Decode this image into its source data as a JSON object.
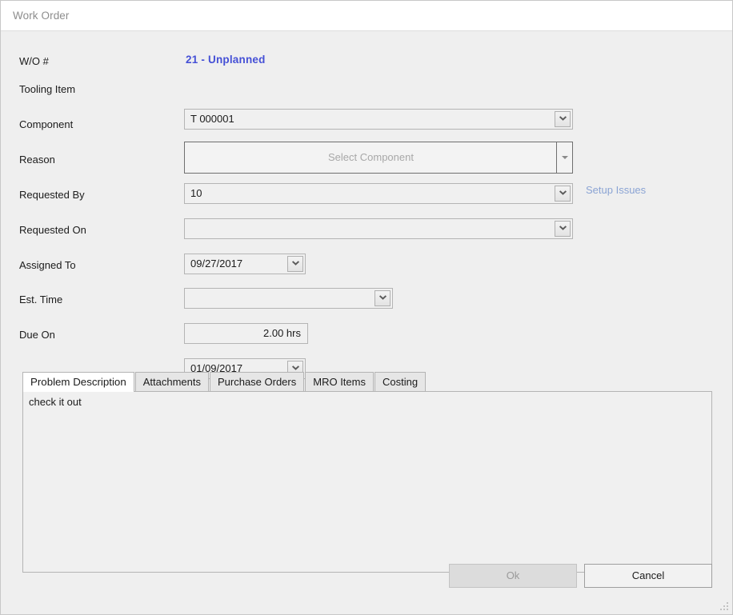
{
  "window": {
    "title": "Work Order"
  },
  "form": {
    "wo_number": {
      "label": "W/O #",
      "value": "21 - Unplanned",
      "color": "#4550d6"
    },
    "fields": [
      {
        "name": "tooling-item",
        "label": "Tooling Item",
        "value": "T 000001",
        "placeholder": "",
        "control": "combobox"
      },
      {
        "name": "component",
        "label": "Component",
        "value": "",
        "placeholder": "Select Component",
        "control": "picker"
      },
      {
        "name": "reason",
        "label": "Reason",
        "value": "10",
        "placeholder": "",
        "control": "combobox"
      },
      {
        "name": "requested-by",
        "label": "Requested By",
        "value": "",
        "placeholder": "",
        "control": "combobox"
      },
      {
        "name": "requested-on",
        "label": "Requested On",
        "value": "09/27/2017",
        "placeholder": "",
        "control": "datepicker"
      },
      {
        "name": "assigned-to",
        "label": "Assigned To",
        "value": "",
        "placeholder": "",
        "control": "combobox"
      },
      {
        "name": "est-time",
        "label": "Est. Time",
        "value": "2.00 hrs",
        "placeholder": "",
        "control": "textbox"
      },
      {
        "name": "due-on",
        "label": "Due On",
        "value": "01/09/2017",
        "placeholder": "",
        "control": "datepicker"
      }
    ],
    "setup_issues_link": "Setup Issues"
  },
  "tabs": {
    "items": [
      {
        "label": "Problem Description",
        "active": true
      },
      {
        "label": "Attachments",
        "active": false
      },
      {
        "label": "Purchase Orders",
        "active": false
      },
      {
        "label": "MRO Items",
        "active": false
      },
      {
        "label": "Costing",
        "active": false
      }
    ],
    "panel_text": "check it out"
  },
  "buttons": {
    "ok": "Ok",
    "cancel": "Cancel"
  },
  "icons": {
    "chevron_down": "chevron-down-icon",
    "caret_down": "caret-down-icon",
    "resize_grip": "resize-grip-icon"
  }
}
